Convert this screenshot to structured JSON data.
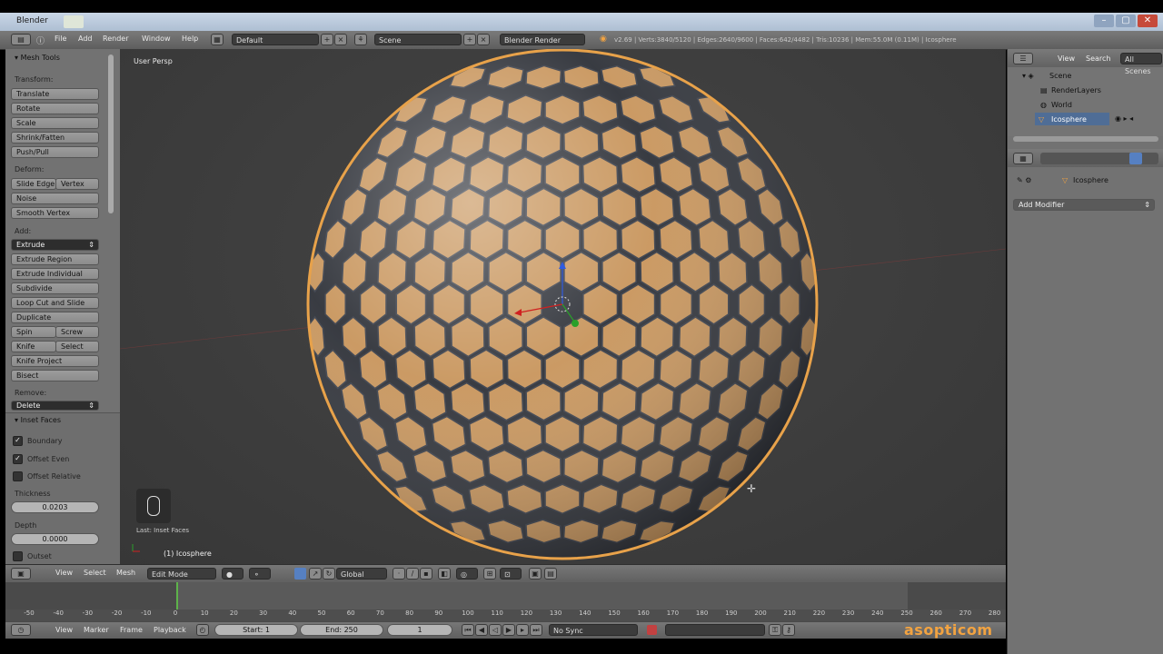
{
  "window": {
    "title": "Blender",
    "buttons": [
      "–",
      "▢",
      "✕"
    ]
  },
  "topbar": {
    "menus": [
      "File",
      "Add",
      "Render",
      "Window",
      "Help"
    ],
    "layout": "Default",
    "scene": "Scene",
    "engine": "Blender Render",
    "info": "v2.69 | Verts:3840/5120 | Edges:2640/9600 | Faces:642/4482 | Tris:10236 | Mem:55.0M (0.11M) | Icosphere"
  },
  "tools": {
    "header": "Mesh Tools",
    "transform_label": "Transform:",
    "transform": [
      "Translate",
      "Rotate",
      "Scale",
      "Shrink/Fatten",
      "Push/Pull"
    ],
    "deform_label": "Deform:",
    "slide_edge": "Slide Edge",
    "vertex": "Vertex",
    "noise": "Noise",
    "smooth_vertex": "Smooth Vertex",
    "add_label": "Add:",
    "extrude": "Extrude",
    "add": [
      "Extrude Region",
      "Extrude Individual",
      "Subdivide",
      "Loop Cut and Slide",
      "Duplicate"
    ],
    "spin": "Spin",
    "screw": "Screw",
    "knife": "Knife",
    "select": "Select",
    "knife_project": "Knife Project",
    "bisect": "Bisect",
    "remove_label": "Remove:",
    "delete": "Delete"
  },
  "inset": {
    "header": "Inset Faces",
    "boundary": "Boundary",
    "offset_even": "Offset Even",
    "offset_relative": "Offset Relative",
    "thickness_label": "Thickness",
    "thickness": "0.0203",
    "depth_label": "Depth",
    "depth": "0.0000",
    "outset": "Outset"
  },
  "viewport": {
    "view_name": "User Persp",
    "object_name": "(1) Icosphere",
    "last_op": "Last: Inset Faces"
  },
  "outliner": {
    "tabs": [
      "View",
      "Search",
      "All Scenes"
    ],
    "items": [
      "Scene",
      "RenderLayers",
      "World",
      "Icosphere"
    ]
  },
  "properties": {
    "object": "Icosphere",
    "add_modifier": "Add Modifier"
  },
  "v3d_header": {
    "menus": [
      "View",
      "Select",
      "Mesh"
    ],
    "mode": "Edit Mode",
    "orientation": "Global"
  },
  "timeline": {
    "ticks": [
      "-50",
      "-40",
      "-30",
      "-20",
      "-10",
      "0",
      "10",
      "20",
      "30",
      "40",
      "50",
      "60",
      "70",
      "80",
      "90",
      "100",
      "110",
      "120",
      "130",
      "140",
      "150",
      "160",
      "170",
      "180",
      "190",
      "200",
      "210",
      "220",
      "230",
      "240",
      "250",
      "260",
      "270",
      "280"
    ],
    "menus": [
      "View",
      "Marker",
      "Frame",
      "Playback"
    ],
    "start": "Start: 1",
    "end": "End: 250",
    "current": "1",
    "sync": "No Sync"
  },
  "watermark": "asopticom",
  "colors": {
    "sphere_face": "#c8955c",
    "sphere_edge": "#3a3f4a",
    "viewport_bg": "#3d3d3d",
    "accent_orange": "#f2a341",
    "selected_edge": "#e8a24a"
  }
}
